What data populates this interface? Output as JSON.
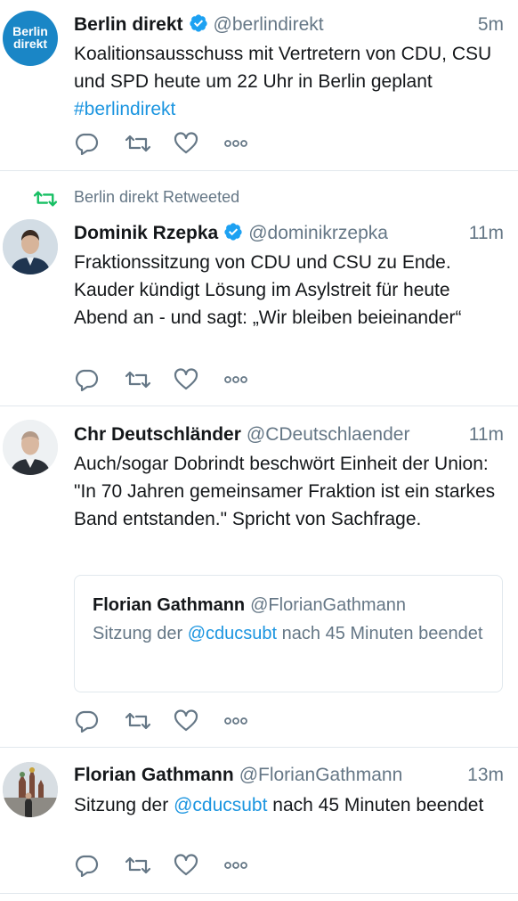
{
  "tweets": [
    {
      "name": "Berlin direkt",
      "handle": "@berlindirekt",
      "time": "5m",
      "text_parts": [
        "Koalitionsausschuss mit Vertretern von CDU, CSU und SPD heute um 22 Uhr in Berlin geplant ",
        "#berlindirekt"
      ],
      "avatar_text": [
        "Berlin",
        "direkt"
      ]
    },
    {
      "retweet_label": "Berlin direkt Retweeted",
      "name": "Dominik Rzepka",
      "handle": "@dominikrzepka",
      "time": "11m",
      "text": "Fraktionssitzung von CDU und CSU zu Ende. Kauder kündigt Lösung im Asylstreit für heute Abend an - und sagt: „Wir bleiben beieinander“"
    },
    {
      "name": "Chr Deutschländer",
      "handle": "@CDeutschlaender",
      "time": "11m",
      "text": "Auch/sogar Dobrindt beschwört Einheit der Union: \"In 70 Jahren gemeinsamer Fraktion ist ein starkes Band entstanden.\" Spricht von Sachfrage.",
      "quote": {
        "name": "Florian Gathmann",
        "handle": "@FlorianGathmann",
        "text_parts": [
          "Sitzung der ",
          "@cducsubt",
          " nach 45 Minuten beendet"
        ]
      }
    },
    {
      "name": "Florian Gathmann",
      "handle": "@FlorianGathmann",
      "time": "13m",
      "text_parts": [
        "Sitzung der ",
        "@cducsubt",
        " nach 45 Minuten beendet"
      ]
    }
  ],
  "colors": {
    "link": "#1b95e0",
    "verified": "#1da1f2",
    "retweet_green": "#17bf63",
    "muted": "#657786",
    "avatar_blue": "#1a86c6"
  },
  "icons": [
    "reply-icon",
    "retweet-icon",
    "like-icon",
    "more-icon",
    "verified-icon"
  ]
}
